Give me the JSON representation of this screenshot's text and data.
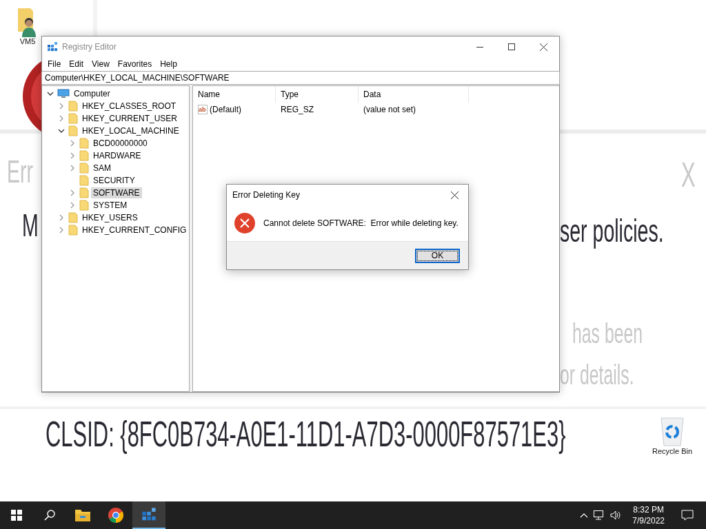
{
  "desktop_icons": [
    {
      "label": "VM5"
    },
    {
      "label": "Recycle Bin"
    }
  ],
  "wallpaper": {
    "texts": [
      {
        "text": "Err",
        "kind": "faint"
      },
      {
        "text": "X",
        "kind": "faint"
      },
      {
        "text": "M",
        "kind": "strong"
      },
      {
        "text": "ser policies.",
        "kind": "strong"
      },
      {
        "text": "has been",
        "kind": "faint"
      },
      {
        "text": "or details.",
        "kind": "faint"
      },
      {
        "text": "CLSID: {8FC0B734-A0E1-11D1-A7D3-0000F87571E3}",
        "kind": "strong"
      }
    ]
  },
  "window": {
    "title": "Registry Editor",
    "menu": [
      "File",
      "Edit",
      "View",
      "Favorites",
      "Help"
    ],
    "address": "Computer\\HKEY_LOCAL_MACHINE\\SOFTWARE",
    "tree": [
      {
        "label": "Computer",
        "kind": "computer",
        "expandable": true,
        "expanded": true,
        "selected": false,
        "children": [
          {
            "label": "HKEY_CLASSES_ROOT",
            "kind": "folder",
            "expandable": true,
            "expanded": false,
            "selected": false
          },
          {
            "label": "HKEY_CURRENT_USER",
            "kind": "folder",
            "expandable": true,
            "expanded": false,
            "selected": false
          },
          {
            "label": "HKEY_LOCAL_MACHINE",
            "kind": "folder",
            "expandable": true,
            "expanded": true,
            "selected": false,
            "children": [
              {
                "label": "BCD00000000",
                "kind": "folder",
                "expandable": true,
                "expanded": false,
                "selected": false
              },
              {
                "label": "HARDWARE",
                "kind": "folder",
                "expandable": true,
                "expanded": false,
                "selected": false
              },
              {
                "label": "SAM",
                "kind": "folder",
                "expandable": true,
                "expanded": false,
                "selected": false
              },
              {
                "label": "SECURITY",
                "kind": "folder",
                "expandable": false,
                "selected": false
              },
              {
                "label": "SOFTWARE",
                "kind": "folder",
                "expandable": true,
                "expanded": false,
                "selected": true
              },
              {
                "label": "SYSTEM",
                "kind": "folder",
                "expandable": true,
                "expanded": false,
                "selected": false
              }
            ]
          },
          {
            "label": "HKEY_USERS",
            "kind": "folder",
            "expandable": true,
            "expanded": false,
            "selected": false
          },
          {
            "label": "HKEY_CURRENT_CONFIG",
            "kind": "folder",
            "expandable": true,
            "expanded": false,
            "selected": false
          }
        ]
      }
    ],
    "columns": [
      "Name",
      "Type",
      "Data"
    ],
    "rows": [
      {
        "icon": "ab",
        "name": "(Default)",
        "type": "REG_SZ",
        "data": "(value not set)"
      }
    ]
  },
  "dialog": {
    "title": "Error Deleting Key",
    "message": "Cannot delete SOFTWARE:  Error while deleting key.",
    "button": "OK"
  },
  "taskbar": {
    "apps": [
      {
        "kind": "start",
        "selected": false
      },
      {
        "kind": "search",
        "selected": false
      },
      {
        "kind": "explorer",
        "selected": false
      },
      {
        "kind": "browser",
        "selected": false
      },
      {
        "kind": "regedit",
        "selected": true
      }
    ],
    "time": "8:32 PM",
    "date": "7/9/2022"
  }
}
